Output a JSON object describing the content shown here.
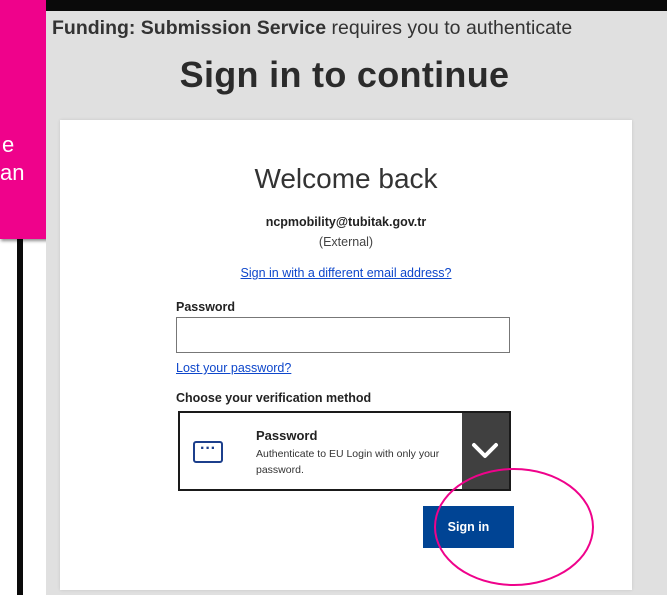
{
  "callout": {
    "text_line1": "e",
    "text_line2": "an",
    "color": "#ef028b"
  },
  "header": {
    "service_name": "Funding: Submission Service",
    "notice_suffix": " requires you to authenticate",
    "title": "Sign in to continue"
  },
  "card": {
    "welcome": "Welcome back",
    "email": "ncpmobility@tubitak.gov.tr",
    "account_type": "(External)",
    "different_email_link": "Sign in with a different email address?",
    "password_label": "Password",
    "password_value": "",
    "lost_password_link": "Lost your password?",
    "verification_label": "Choose your verification method",
    "method": {
      "title": "Password",
      "description": "Authenticate to EU Login with only your password.",
      "icon": "password-dots-icon",
      "dropdown_icon": "chevron-down-icon"
    },
    "signin_button": "Sign in"
  },
  "colors": {
    "accent_blue": "#004494",
    "link_blue": "#0e47cb",
    "highlight_pink": "#ef028b",
    "page_grey": "#e0e0e0"
  }
}
